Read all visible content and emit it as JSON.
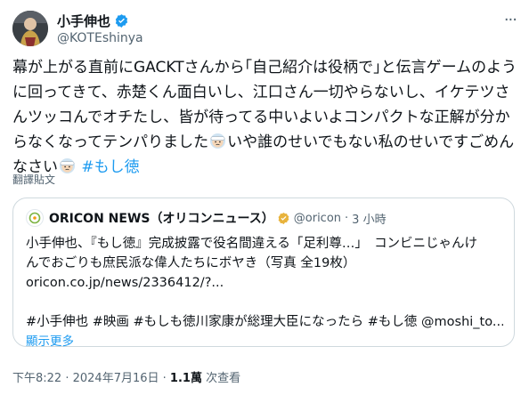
{
  "author": {
    "display_name": "小手伸也",
    "handle": "@KOTEshinya",
    "verified": true
  },
  "menu": {
    "more_label": "···"
  },
  "tweet": {
    "text_part1": "幕が上がる直前にGACKTさんから｢自己紹介は役柄で｣と伝言ゲームのように回ってきて、赤楚くん面白いし、江口さん一切やらないし、イケテツさんツッコんでオチたし、皆が待ってる中いよいよコンパクトな正解が分からなくなってテンパりました",
    "text_part2": "いや誰のせいでもない私のせいですごめんなさい",
    "hashtag": "#もし徳",
    "emoji_names": [
      "face-with-bandage-emoji",
      "face-with-bandage-emoji"
    ]
  },
  "translate_label": "翻譯貼文",
  "quote": {
    "name": "ORICON NEWS（オリコンニュース）",
    "handle": "@oricon",
    "separator": "·",
    "time": "3 小時",
    "line1": "小手伸也、『もし徳』完成披露で役名間違える「足利尊…」　コンビニじゃんけ",
    "line2": "んでおごりも庶民派な偉人たちにボヤき（写真 全19枚）",
    "line3": "oricon.co.jp/news/2336412/?...",
    "line4": "#小手伸也 #映画 #もしも徳川家康が総理大臣になったら #もし徳 @moshi_to...",
    "show_more": "顯示更多"
  },
  "footer": {
    "time": "下午8:22",
    "sep1": " · ",
    "date": "2024年7月16日",
    "sep2": " · ",
    "views_count": "1.1萬",
    "views_label": " 次查看"
  },
  "colors": {
    "accent": "#1d9bf0",
    "text": "#0f1419",
    "muted": "#536471",
    "border": "#cfd9de"
  }
}
